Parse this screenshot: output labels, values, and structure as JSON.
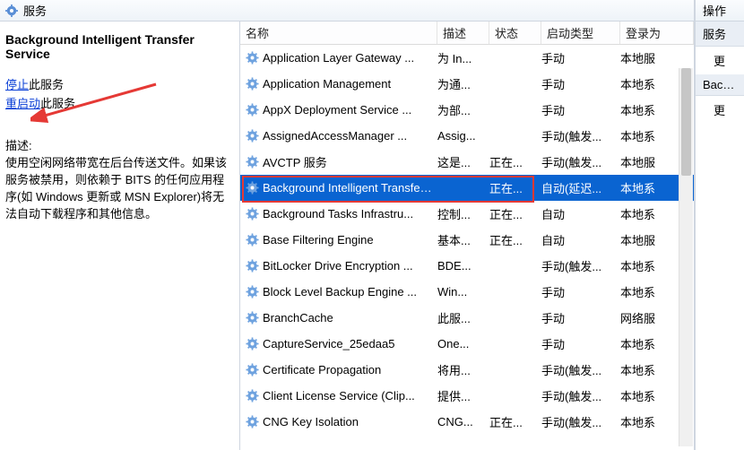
{
  "title_bar": "服务",
  "detail": {
    "service_name": "Background Intelligent Transfer Service",
    "stop_link": "停止",
    "stop_suffix": "此服务",
    "restart_link": "重启动",
    "restart_suffix": "此服务",
    "desc_label": "描述:",
    "desc_text": "使用空闲网络带宽在后台传送文件。如果该服务被禁用，则依赖于 BITS 的任何应用程序(如 Windows 更新或 MSN Explorer)将无法自动下载程序和其他信息。"
  },
  "columns": {
    "name": "名称",
    "desc": "描述",
    "status": "状态",
    "startup": "启动类型",
    "logon": "登录为"
  },
  "services": [
    {
      "name": "Application Layer Gateway ...",
      "desc": "为 In...",
      "status": "",
      "startup": "手动",
      "logon": "本地服"
    },
    {
      "name": "Application Management",
      "desc": "为通...",
      "status": "",
      "startup": "手动",
      "logon": "本地系"
    },
    {
      "name": "AppX Deployment Service ...",
      "desc": "为部...",
      "status": "",
      "startup": "手动",
      "logon": "本地系"
    },
    {
      "name": "AssignedAccessManager ...",
      "desc": "Assig...",
      "status": "",
      "startup": "手动(触发...",
      "logon": "本地系"
    },
    {
      "name": "AVCTP 服务",
      "desc": "这是...",
      "status": "正在...",
      "startup": "手动(触发...",
      "logon": "本地服"
    },
    {
      "name": "Background Intelligent Transfer Service",
      "desc": "",
      "status": "正在...",
      "startup": "自动(延迟...",
      "logon": "本地系",
      "selected": true
    },
    {
      "name": "Background Tasks Infrastru...",
      "desc": "控制...",
      "status": "正在...",
      "startup": "自动",
      "logon": "本地系"
    },
    {
      "name": "Base Filtering Engine",
      "desc": "基本...",
      "status": "正在...",
      "startup": "自动",
      "logon": "本地服"
    },
    {
      "name": "BitLocker Drive Encryption ...",
      "desc": "BDE...",
      "status": "",
      "startup": "手动(触发...",
      "logon": "本地系"
    },
    {
      "name": "Block Level Backup Engine ...",
      "desc": "Win...",
      "status": "",
      "startup": "手动",
      "logon": "本地系"
    },
    {
      "name": "BranchCache",
      "desc": "此服...",
      "status": "",
      "startup": "手动",
      "logon": "网络服"
    },
    {
      "name": "CaptureService_25edaa5",
      "desc": "One...",
      "status": "",
      "startup": "手动",
      "logon": "本地系"
    },
    {
      "name": "Certificate Propagation",
      "desc": "将用...",
      "status": "",
      "startup": "手动(触发...",
      "logon": "本地系"
    },
    {
      "name": "Client License Service (Clip...",
      "desc": "提供...",
      "status": "",
      "startup": "手动(触发...",
      "logon": "本地系"
    },
    {
      "name": "CNG Key Isolation",
      "desc": "CNG...",
      "status": "正在...",
      "startup": "手动(触发...",
      "logon": "本地系"
    }
  ],
  "actions": {
    "title": "操作",
    "group1": "服务",
    "item1": "更",
    "group2": "Backgr",
    "item2": "更"
  }
}
